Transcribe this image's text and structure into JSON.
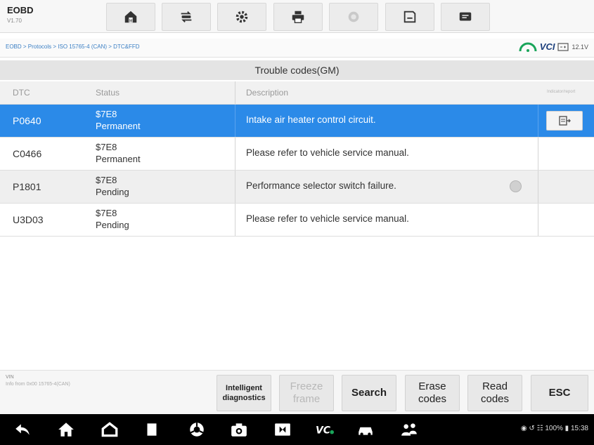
{
  "toolbar": {
    "title": "EOBD",
    "version": "V1.70",
    "buttons": [
      "home-icon",
      "vehicle-swap-icon",
      "settings-icon",
      "print-icon",
      "help-icon",
      "save-icon",
      "message-icon"
    ]
  },
  "breadcrumb": "EOBD > Protocols > ISO 15765-4 (CAN) > DTC&FFD",
  "vci": {
    "label": "VCI",
    "voltage": "12.1V"
  },
  "section_title": "Trouble codes(GM)",
  "table": {
    "headers": {
      "dtc": "DTC",
      "status": "Status",
      "description": "Description",
      "extra": "Indicator/report"
    },
    "rows": [
      {
        "code": "P0640",
        "status_line1": "$7E8",
        "status_line2": "Permanent",
        "description": "Intake air heater control circuit."
      },
      {
        "code": "C0466",
        "status_line1": "$7E8",
        "status_line2": "Permanent",
        "description": "Please refer to vehicle service manual."
      },
      {
        "code": "P1801",
        "status_line1": "$7E8",
        "status_line2": "Pending",
        "description": "Performance selector switch failure."
      },
      {
        "code": "U3D03",
        "status_line1": "$7E8",
        "status_line2": "Pending",
        "description": "Please refer to vehicle service manual."
      }
    ]
  },
  "footer": {
    "vin_label": "VIN",
    "vin_value": "Info from 0x00 15765-4(CAN)",
    "buttons": {
      "intelligent": "Intelligent diagnostics",
      "freeze": "Freeze frame",
      "search": "Search",
      "erase": "Erase codes",
      "read": "Read codes",
      "esc": "ESC"
    }
  },
  "system_status": "◉ ↺  ☷ 100% ▮ 15:38",
  "colors": {
    "selected_row": "#2b8ae8",
    "accent": "#1c3f7c"
  }
}
